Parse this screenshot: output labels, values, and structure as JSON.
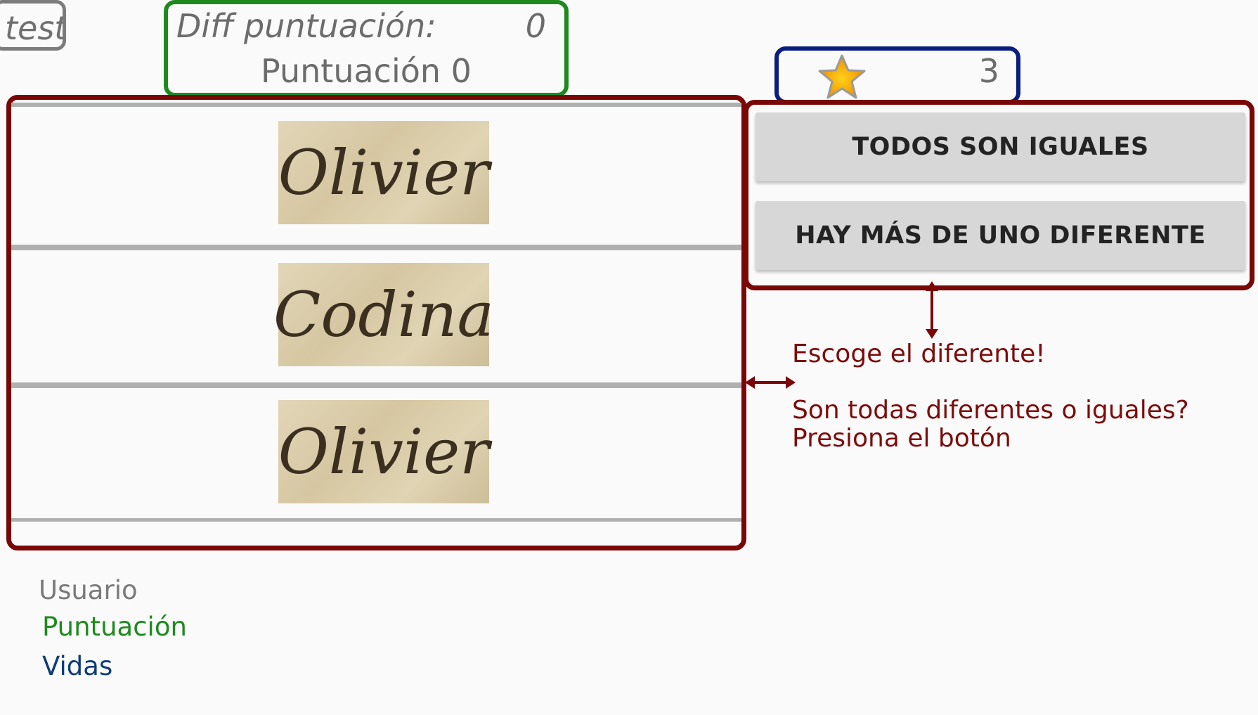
{
  "user": {
    "name": "test"
  },
  "score_box": {
    "diff_label": "Diff puntuación:",
    "diff_value": "0",
    "score_line": "Puntuación 0"
  },
  "lives": {
    "count": "3",
    "icon": "star-icon"
  },
  "words": [
    {
      "text": "Olivier"
    },
    {
      "text": "Codina"
    },
    {
      "text": "Olivier"
    }
  ],
  "buttons": {
    "all_same": "TODOS SON IGUALES",
    "more_than_one_different": "HAY MÁS DE UNO DIFERENTE"
  },
  "annotations": {
    "pick_different": "Escoge el diferente!",
    "question_line1": "Son todas diferentes o iguales?",
    "question_line2": "Presiona el botón"
  },
  "legend": {
    "user": "Usuario",
    "score": "Puntuación",
    "lives": "Vidas"
  },
  "colors": {
    "annotation_red": "#7a0707",
    "score_green": "#1e8a1e",
    "lives_blue": "#0a1e7d",
    "user_gray": "#7c7c7c"
  }
}
